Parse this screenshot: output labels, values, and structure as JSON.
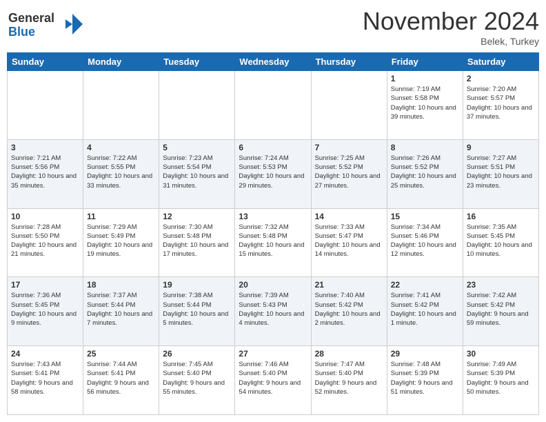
{
  "logo": {
    "line1": "General",
    "line2": "Blue"
  },
  "title": "November 2024",
  "location": "Belek, Turkey",
  "days_of_week": [
    "Sunday",
    "Monday",
    "Tuesday",
    "Wednesday",
    "Thursday",
    "Friday",
    "Saturday"
  ],
  "weeks": [
    [
      {
        "day": "",
        "info": ""
      },
      {
        "day": "",
        "info": ""
      },
      {
        "day": "",
        "info": ""
      },
      {
        "day": "",
        "info": ""
      },
      {
        "day": "",
        "info": ""
      },
      {
        "day": "1",
        "info": "Sunrise: 7:19 AM\nSunset: 5:58 PM\nDaylight: 10 hours and 39 minutes."
      },
      {
        "day": "2",
        "info": "Sunrise: 7:20 AM\nSunset: 5:57 PM\nDaylight: 10 hours and 37 minutes."
      }
    ],
    [
      {
        "day": "3",
        "info": "Sunrise: 7:21 AM\nSunset: 5:56 PM\nDaylight: 10 hours and 35 minutes."
      },
      {
        "day": "4",
        "info": "Sunrise: 7:22 AM\nSunset: 5:55 PM\nDaylight: 10 hours and 33 minutes."
      },
      {
        "day": "5",
        "info": "Sunrise: 7:23 AM\nSunset: 5:54 PM\nDaylight: 10 hours and 31 minutes."
      },
      {
        "day": "6",
        "info": "Sunrise: 7:24 AM\nSunset: 5:53 PM\nDaylight: 10 hours and 29 minutes."
      },
      {
        "day": "7",
        "info": "Sunrise: 7:25 AM\nSunset: 5:52 PM\nDaylight: 10 hours and 27 minutes."
      },
      {
        "day": "8",
        "info": "Sunrise: 7:26 AM\nSunset: 5:52 PM\nDaylight: 10 hours and 25 minutes."
      },
      {
        "day": "9",
        "info": "Sunrise: 7:27 AM\nSunset: 5:51 PM\nDaylight: 10 hours and 23 minutes."
      }
    ],
    [
      {
        "day": "10",
        "info": "Sunrise: 7:28 AM\nSunset: 5:50 PM\nDaylight: 10 hours and 21 minutes."
      },
      {
        "day": "11",
        "info": "Sunrise: 7:29 AM\nSunset: 5:49 PM\nDaylight: 10 hours and 19 minutes."
      },
      {
        "day": "12",
        "info": "Sunrise: 7:30 AM\nSunset: 5:48 PM\nDaylight: 10 hours and 17 minutes."
      },
      {
        "day": "13",
        "info": "Sunrise: 7:32 AM\nSunset: 5:48 PM\nDaylight: 10 hours and 15 minutes."
      },
      {
        "day": "14",
        "info": "Sunrise: 7:33 AM\nSunset: 5:47 PM\nDaylight: 10 hours and 14 minutes."
      },
      {
        "day": "15",
        "info": "Sunrise: 7:34 AM\nSunset: 5:46 PM\nDaylight: 10 hours and 12 minutes."
      },
      {
        "day": "16",
        "info": "Sunrise: 7:35 AM\nSunset: 5:45 PM\nDaylight: 10 hours and 10 minutes."
      }
    ],
    [
      {
        "day": "17",
        "info": "Sunrise: 7:36 AM\nSunset: 5:45 PM\nDaylight: 10 hours and 9 minutes."
      },
      {
        "day": "18",
        "info": "Sunrise: 7:37 AM\nSunset: 5:44 PM\nDaylight: 10 hours and 7 minutes."
      },
      {
        "day": "19",
        "info": "Sunrise: 7:38 AM\nSunset: 5:44 PM\nDaylight: 10 hours and 5 minutes."
      },
      {
        "day": "20",
        "info": "Sunrise: 7:39 AM\nSunset: 5:43 PM\nDaylight: 10 hours and 4 minutes."
      },
      {
        "day": "21",
        "info": "Sunrise: 7:40 AM\nSunset: 5:42 PM\nDaylight: 10 hours and 2 minutes."
      },
      {
        "day": "22",
        "info": "Sunrise: 7:41 AM\nSunset: 5:42 PM\nDaylight: 10 hours and 1 minute."
      },
      {
        "day": "23",
        "info": "Sunrise: 7:42 AM\nSunset: 5:42 PM\nDaylight: 9 hours and 59 minutes."
      }
    ],
    [
      {
        "day": "24",
        "info": "Sunrise: 7:43 AM\nSunset: 5:41 PM\nDaylight: 9 hours and 58 minutes."
      },
      {
        "day": "25",
        "info": "Sunrise: 7:44 AM\nSunset: 5:41 PM\nDaylight: 9 hours and 56 minutes."
      },
      {
        "day": "26",
        "info": "Sunrise: 7:45 AM\nSunset: 5:40 PM\nDaylight: 9 hours and 55 minutes."
      },
      {
        "day": "27",
        "info": "Sunrise: 7:46 AM\nSunset: 5:40 PM\nDaylight: 9 hours and 54 minutes."
      },
      {
        "day": "28",
        "info": "Sunrise: 7:47 AM\nSunset: 5:40 PM\nDaylight: 9 hours and 52 minutes."
      },
      {
        "day": "29",
        "info": "Sunrise: 7:48 AM\nSunset: 5:39 PM\nDaylight: 9 hours and 51 minutes."
      },
      {
        "day": "30",
        "info": "Sunrise: 7:49 AM\nSunset: 5:39 PM\nDaylight: 9 hours and 50 minutes."
      }
    ]
  ]
}
